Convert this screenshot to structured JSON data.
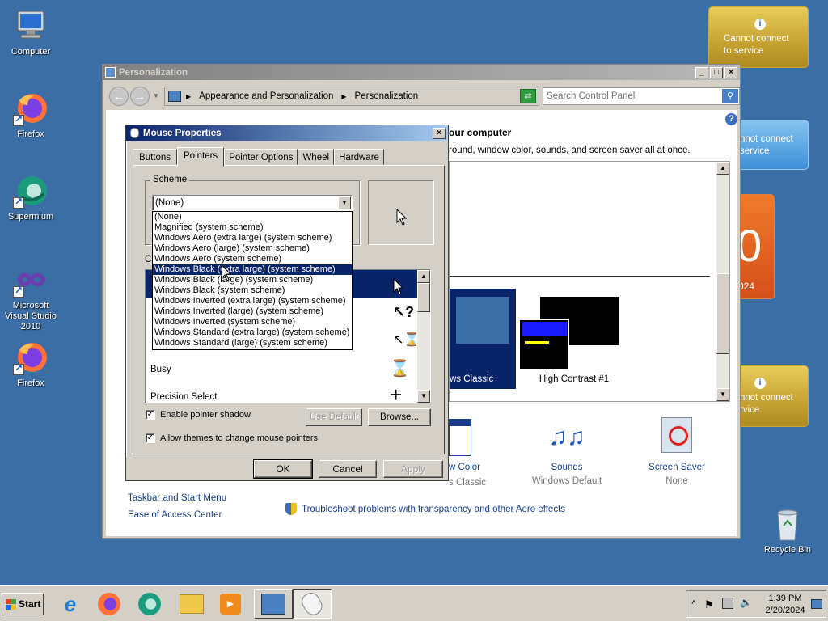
{
  "desktop": {
    "icons": [
      {
        "label": "Computer"
      },
      {
        "label": "Firefox"
      },
      {
        "label": "Supermium"
      },
      {
        "label": "Microsoft Visual Studio 2010"
      },
      {
        "label": "Firefox"
      },
      {
        "label": "Recycle Bin"
      }
    ],
    "gadgets": {
      "weather1": "Cannot connect to service",
      "weather2": "nnot connect service",
      "calendar_day": "0",
      "calendar_year": "024",
      "weather3": "nnot connect rvice",
      "info_glyph": "i"
    }
  },
  "personalization": {
    "title": "Personalization",
    "breadcrumb": [
      "Appearance and Personalization",
      "Personalization"
    ],
    "search_placeholder": "Search Control Panel",
    "heading": "our computer",
    "subheading": "round, window color, sounds, and screen saver all at once.",
    "themes": [
      {
        "label": "ws Classic"
      },
      {
        "label": "High Contrast #1"
      }
    ],
    "bottom_items": [
      {
        "label": "w Color",
        "sub": "s Classic"
      },
      {
        "label": "Sounds",
        "sub": "Windows Default"
      },
      {
        "label": "Screen Saver",
        "sub": "None"
      }
    ],
    "see_also": [
      "Taskbar and Start Menu",
      "Ease of Access Center"
    ],
    "troubleshoot": "Troubleshoot problems with transparency and other Aero effects",
    "help_glyph": "?"
  },
  "mouse": {
    "title": "Mouse Properties",
    "tabs": [
      "Buttons",
      "Pointers",
      "Pointer Options",
      "Wheel",
      "Hardware"
    ],
    "active_tab": "Pointers",
    "scheme_label": "Scheme",
    "scheme_value": "(None)",
    "customize_label": "C",
    "dropdown_options": [
      "(None)",
      "Magnified (system scheme)",
      "Windows Aero (extra large) (system scheme)",
      "Windows Aero (large) (system scheme)",
      "Windows Aero (system scheme)",
      "Windows Black (extra large) (system scheme)",
      "Windows Black (large) (system scheme)",
      "Windows Black (system scheme)",
      "Windows Inverted (extra large) (system scheme)",
      "Windows Inverted (large) (system scheme)",
      "Windows Inverted (system scheme)",
      "Windows Standard (extra large) (system scheme)",
      "Windows Standard (large) (system scheme)"
    ],
    "highlighted_option": "Windows Black (extra large) (system scheme)",
    "pointer_rows": [
      {
        "label": "Busy"
      },
      {
        "label": "Precision Select"
      }
    ],
    "enable_shadow": "Enable pointer shadow",
    "allow_themes": "Allow themes to change mouse pointers",
    "use_default": "Use Default",
    "browse": "Browse...",
    "ok": "OK",
    "cancel": "Cancel",
    "apply": "Apply",
    "close_glyph": "×"
  },
  "taskbar": {
    "start": "Start",
    "time": "1:39 PM",
    "date": "2/20/2024"
  },
  "colors": {
    "desktop": "#3a6ea5",
    "selection": "#0a246a",
    "face": "#d4d0c8"
  }
}
